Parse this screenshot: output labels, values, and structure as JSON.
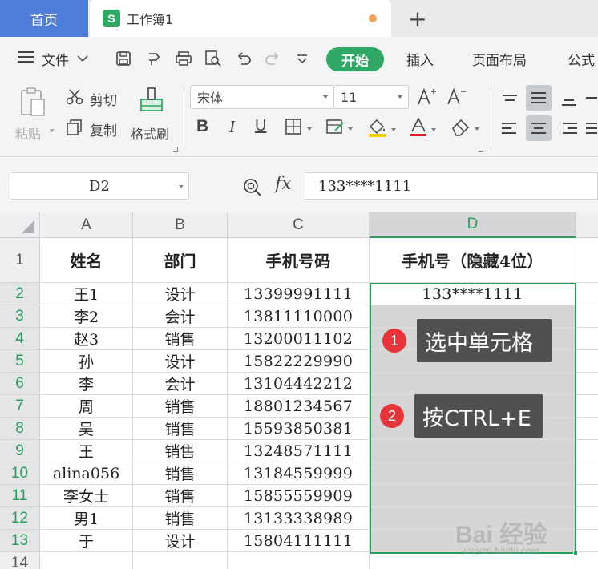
{
  "tabs": {
    "home_label": "首页",
    "doc_label": "工作簿1",
    "doc_icon": "S",
    "plus": "+"
  },
  "menu": {
    "file_label": "文件",
    "start_label": "开始",
    "insert_label": "插入",
    "page_layout_label": "页面布局",
    "formula_label": "公式"
  },
  "ribbon": {
    "paste_label": "粘贴",
    "cut_label": "剪切",
    "copy_label": "复制",
    "format_painter_label": "格式刷",
    "font_name": "宋体",
    "font_size": "11",
    "bold": "B",
    "italic": "I",
    "underline": "U"
  },
  "formula_bar": {
    "cell_ref": "D2",
    "fx": "fx",
    "value": "133****1111"
  },
  "sheet": {
    "columns": [
      "A",
      "B",
      "C",
      "D"
    ],
    "header": {
      "name": "姓名",
      "dept": "部门",
      "phone": "手机号码",
      "masked": "手机号（隐藏4位）"
    },
    "rows": [
      {
        "num": "1"
      },
      {
        "num": "2",
        "name": "王1",
        "dept": "设计",
        "phone": "13399991111",
        "masked": "133****1111"
      },
      {
        "num": "3",
        "name": "李2",
        "dept": "会计",
        "phone": "13811110000"
      },
      {
        "num": "4",
        "name": "赵3",
        "dept": "销售",
        "phone": "13200011102"
      },
      {
        "num": "5",
        "name": "孙",
        "dept": "设计",
        "phone": "15822229990"
      },
      {
        "num": "6",
        "name": "李",
        "dept": "会计",
        "phone": "13104442212"
      },
      {
        "num": "7",
        "name": "周",
        "dept": "销售",
        "phone": "18801234567"
      },
      {
        "num": "8",
        "name": "吴",
        "dept": "销售",
        "phone": "15593850381"
      },
      {
        "num": "9",
        "name": "王",
        "dept": "销售",
        "phone": "13248571111"
      },
      {
        "num": "10",
        "name": "alina056",
        "dept": "销售",
        "phone": "13184559999"
      },
      {
        "num": "11",
        "name": "李女士",
        "dept": "销售",
        "phone": "15855559909"
      },
      {
        "num": "12",
        "name": "男1",
        "dept": "销售",
        "phone": "13133338989"
      },
      {
        "num": "13",
        "name": "于",
        "dept": "设计",
        "phone": "15804111111"
      },
      {
        "num": "14"
      }
    ]
  },
  "callouts": [
    {
      "badge": "1",
      "text": "选中单元格"
    },
    {
      "badge": "2",
      "text": "按CTRL+E"
    }
  ],
  "watermark": {
    "main": "Bai 经验",
    "sub": "jingyan.baidu.com"
  },
  "colors": {
    "accent_green": "#2fa866",
    "selection_green": "#2a9d5b",
    "home_tab_blue": "#4f7ed8",
    "badge_red": "#e5353a",
    "callout_bg": "#505050"
  }
}
